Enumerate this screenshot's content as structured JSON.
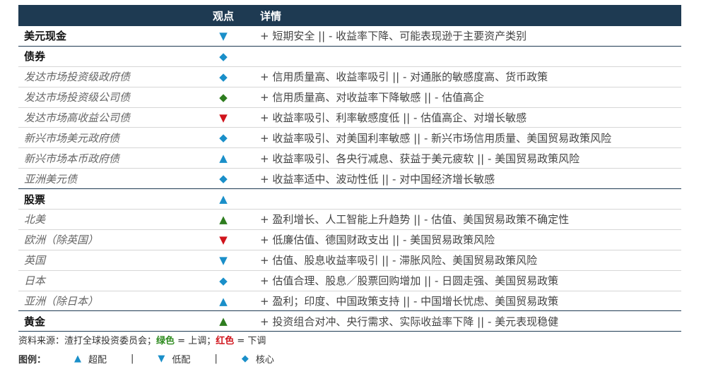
{
  "header": {
    "view": "观点",
    "detail": "详情"
  },
  "rows": [
    {
      "name": "美元现金",
      "style": "cat",
      "symbol": "▼",
      "color": "down-blue",
      "detail": "+ 短期安全 || - 收益率下降、可能表现逊于主要资产类别",
      "border": "top"
    },
    {
      "name": "债券",
      "style": "cat",
      "symbol": "◆",
      "color": "dia-blue",
      "detail": "",
      "border": ""
    },
    {
      "name": "发达市场投资级政府债",
      "style": "sub",
      "symbol": "◆",
      "color": "dia-blue",
      "detail": "+ 信用质量高、收益率吸引 || - 对通胀的敏感度高、货币政策",
      "border": ""
    },
    {
      "name": "发达市场投资级公司债",
      "style": "sub",
      "symbol": "◆",
      "color": "dia-green",
      "detail": "+ 信用质量高、对收益率下降敏感 || - 估值高企",
      "border": ""
    },
    {
      "name": "发达市场高收益公司债",
      "style": "sub",
      "symbol": "▼",
      "color": "down-red",
      "detail": "+ 收益率吸引、利率敏感度低 || - 估值高企、对增长敏感",
      "border": ""
    },
    {
      "name": "新兴市场美元政府债",
      "style": "sub",
      "symbol": "◆",
      "color": "dia-blue",
      "detail": "+ 收益率吸引、对美国利率敏感 || - 新兴市场信用质量、美国贸易政策风险",
      "border": ""
    },
    {
      "name": "新兴市场本币政府债",
      "style": "sub",
      "symbol": "▲",
      "color": "up-blue",
      "detail": "+ 收益率吸引、各央行减息、获益于美元疲软 || - 美国贸易政策风险",
      "border": ""
    },
    {
      "name": "亚洲美元债",
      "style": "sub",
      "symbol": "◆",
      "color": "dia-blue",
      "detail": "+ 收益率适中、波动性低 || - 对中国经济增长敏感",
      "border": "group-end"
    },
    {
      "name": "股票",
      "style": "cat",
      "symbol": "▲",
      "color": "up-blue",
      "detail": "",
      "border": ""
    },
    {
      "name": "北美",
      "style": "sub",
      "symbol": "▲",
      "color": "up-green",
      "detail": "+ 盈利增长、人工智能上升趋势 || - 估值、美国贸易政策不确定性",
      "border": ""
    },
    {
      "name": "欧洲（除英国）",
      "style": "sub",
      "symbol": "▼",
      "color": "down-red",
      "detail": "+ 低廉估值、德国财政支出 || - 美国贸易政策风险",
      "border": ""
    },
    {
      "name": "英国",
      "style": "sub",
      "symbol": "▼",
      "color": "down-blue",
      "detail": "+ 估值、股息收益率吸引 || - 滞胀风险、美国贸易政策风险",
      "border": ""
    },
    {
      "name": "日本",
      "style": "sub",
      "symbol": "◆",
      "color": "dia-blue",
      "detail": "+ 估值合理、股息／股票回购增加 || - 日圆走强、美国贸易政策",
      "border": ""
    },
    {
      "name": "亚洲（除日本）",
      "style": "sub",
      "symbol": "▲",
      "color": "up-blue",
      "detail": "+ 盈利；印度、中国政策支持 || - 中国增长忧虑、美国贸易政策",
      "border": "group-end"
    },
    {
      "name": "黄金",
      "style": "cat",
      "symbol": "▲",
      "color": "up-green",
      "detail": "+ 投资组合对冲、央行需求、实际收益率下降 || - 美元表现稳健",
      "border": "group-end"
    }
  ],
  "source": {
    "prefix": "资料来源：渣打全球投资委员会；",
    "green_word": "绿色",
    "green_rest": " = 上调；",
    "red_word": "红色",
    "red_rest": " = 下调"
  },
  "legend": {
    "label": "图例：",
    "items": [
      {
        "symbol": "▲",
        "text": "超配"
      },
      {
        "symbol": "▼",
        "text": "低配"
      },
      {
        "symbol": "◆",
        "text": "核心"
      }
    ],
    "separator": "|"
  }
}
